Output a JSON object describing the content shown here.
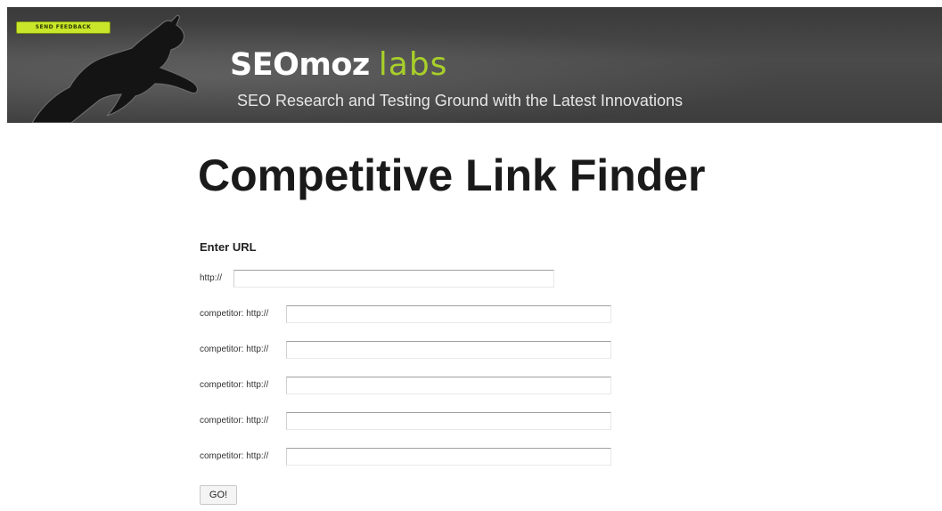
{
  "header": {
    "feedback_label": "SEND FEEDBACK",
    "logo_main": "SEOmoz",
    "logo_sub": "labs",
    "tagline": "SEO Research and Testing Ground with the Latest Innovations",
    "accent_color": "#a8cf2a",
    "feedback_color": "#c9e62a",
    "background_color": "#3d3d3d",
    "mascot_icon": "leaping-dog-icon"
  },
  "main": {
    "title": "Competitive Link Finder",
    "enter_url_label": "Enter URL",
    "primary_field": {
      "label": "http://",
      "value": "",
      "placeholder": ""
    },
    "competitor_fields": [
      {
        "label": "competitor: http://",
        "value": "",
        "placeholder": ""
      },
      {
        "label": "competitor: http://",
        "value": "",
        "placeholder": ""
      },
      {
        "label": "competitor: http://",
        "value": "",
        "placeholder": ""
      },
      {
        "label": "competitor: http://",
        "value": "",
        "placeholder": ""
      },
      {
        "label": "competitor: http://",
        "value": "",
        "placeholder": ""
      }
    ],
    "go_label": "GO!"
  }
}
